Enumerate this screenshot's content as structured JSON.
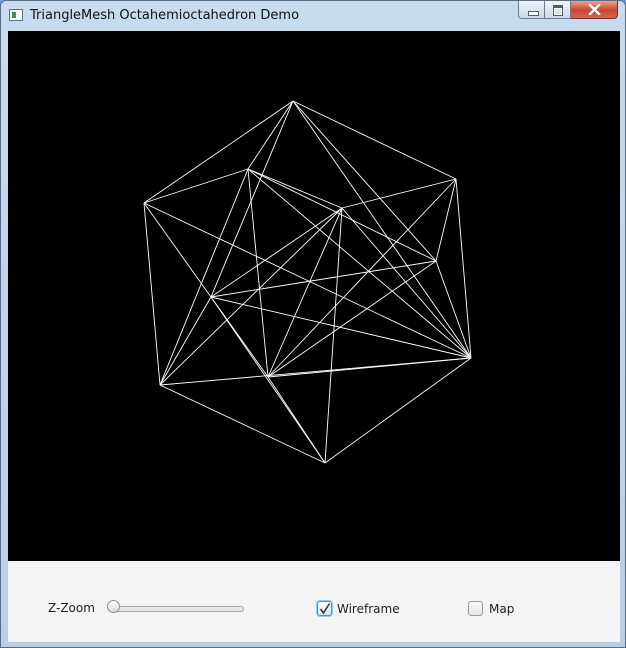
{
  "window": {
    "title": "TriangleMesh Octahemioctahedron Demo",
    "icon": "app-window-icon",
    "caption_buttons": [
      "minimize-icon",
      "maximize-icon",
      "close-icon"
    ]
  },
  "viewport": {
    "background": "#000000",
    "wire_color": "#ffffff",
    "content": "octahemioctahedron-wireframe"
  },
  "controls": {
    "zoom": {
      "label": "Z-Zoom",
      "value": 0.0
    },
    "wireframe": {
      "label": "Wireframe",
      "checked": true
    },
    "map": {
      "label": "Map",
      "checked": false
    }
  }
}
